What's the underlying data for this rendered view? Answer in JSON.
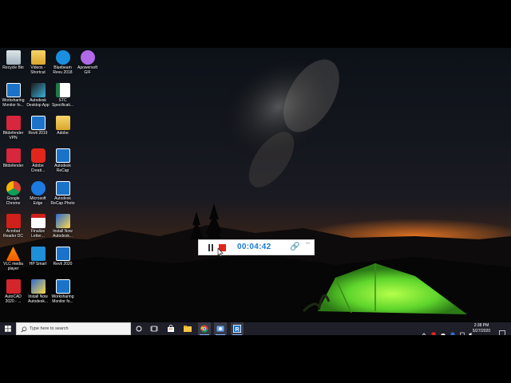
{
  "desktop": {
    "icons": [
      {
        "label": "Recycle Bin",
        "icon": "recycle-bin-icon"
      },
      {
        "label": "Videos - Shortcut",
        "icon": "folder-shortcut-icon"
      },
      {
        "label": "Bluebeam Revu 2018",
        "icon": "bluebeam-icon"
      },
      {
        "label": "Apowersoft GIF",
        "icon": "apowersoft-gif-icon"
      },
      {
        "label": "Worksharing Monitor fo...",
        "icon": "revit-icon"
      },
      {
        "label": "Autodesk Desktop App",
        "icon": "autodesk-app-icon"
      },
      {
        "label": "STC Specificati...",
        "icon": "excel-file-icon"
      },
      {
        "label": "Bitdefender VPN",
        "icon": "bitdefender-vpn-icon"
      },
      {
        "label": "Revit 2019",
        "icon": "revit-icon"
      },
      {
        "label": "Adobe",
        "icon": "folder-icon"
      },
      {
        "label": "Bitdefender",
        "icon": "bitdefender-icon"
      },
      {
        "label": "Adobe Creati...",
        "icon": "adobe-cc-icon"
      },
      {
        "label": "Autodesk ReCap",
        "icon": "recap-icon"
      },
      {
        "label": "Google Chrome",
        "icon": "chrome-icon"
      },
      {
        "label": "Microsoft Edge",
        "icon": "edge-icon"
      },
      {
        "label": "Autodesk ReCap Photo",
        "icon": "recap-icon"
      },
      {
        "label": "Acrobat Reader DC",
        "icon": "acrobat-icon"
      },
      {
        "label": "Finalize Letter... Res...",
        "icon": "pdf-file-icon"
      },
      {
        "label": "Install Now Autodesk...",
        "icon": "installer-icon"
      },
      {
        "label": "VLC media player",
        "icon": "vlc-icon"
      },
      {
        "label": "HP Smart",
        "icon": "hp-smart-icon"
      },
      {
        "label": "Revit 2020",
        "icon": "revit-icon"
      },
      {
        "label": "AutoCAD 2020 - ...",
        "icon": "autocad-icon"
      },
      {
        "label": "Install Now Autodesk...",
        "icon": "installer-icon"
      },
      {
        "label": "Worksharing Monitor fo...",
        "icon": "revit-icon"
      }
    ]
  },
  "recorder": {
    "timer": "00:04:42",
    "pause_icon": "pause-icon",
    "stop_icon": "stop-icon",
    "pin_icon": "pin-icon",
    "minimize_icon": "minimize-icon"
  },
  "taskbar": {
    "search_placeholder": "Type here to search",
    "pinned": [
      "cortana-icon",
      "task-view-icon",
      "store-icon",
      "file-explorer-icon",
      "chrome-icon",
      "screen-recorder-icon",
      "revit-icon"
    ],
    "clock_time": "2:38 PM",
    "clock_date": "5/27/2020"
  },
  "colors": {
    "taskbar": "#1f1f2a",
    "timer": "#1c7bd1",
    "stop": "#e0261b",
    "tent": "#5fd52c"
  }
}
